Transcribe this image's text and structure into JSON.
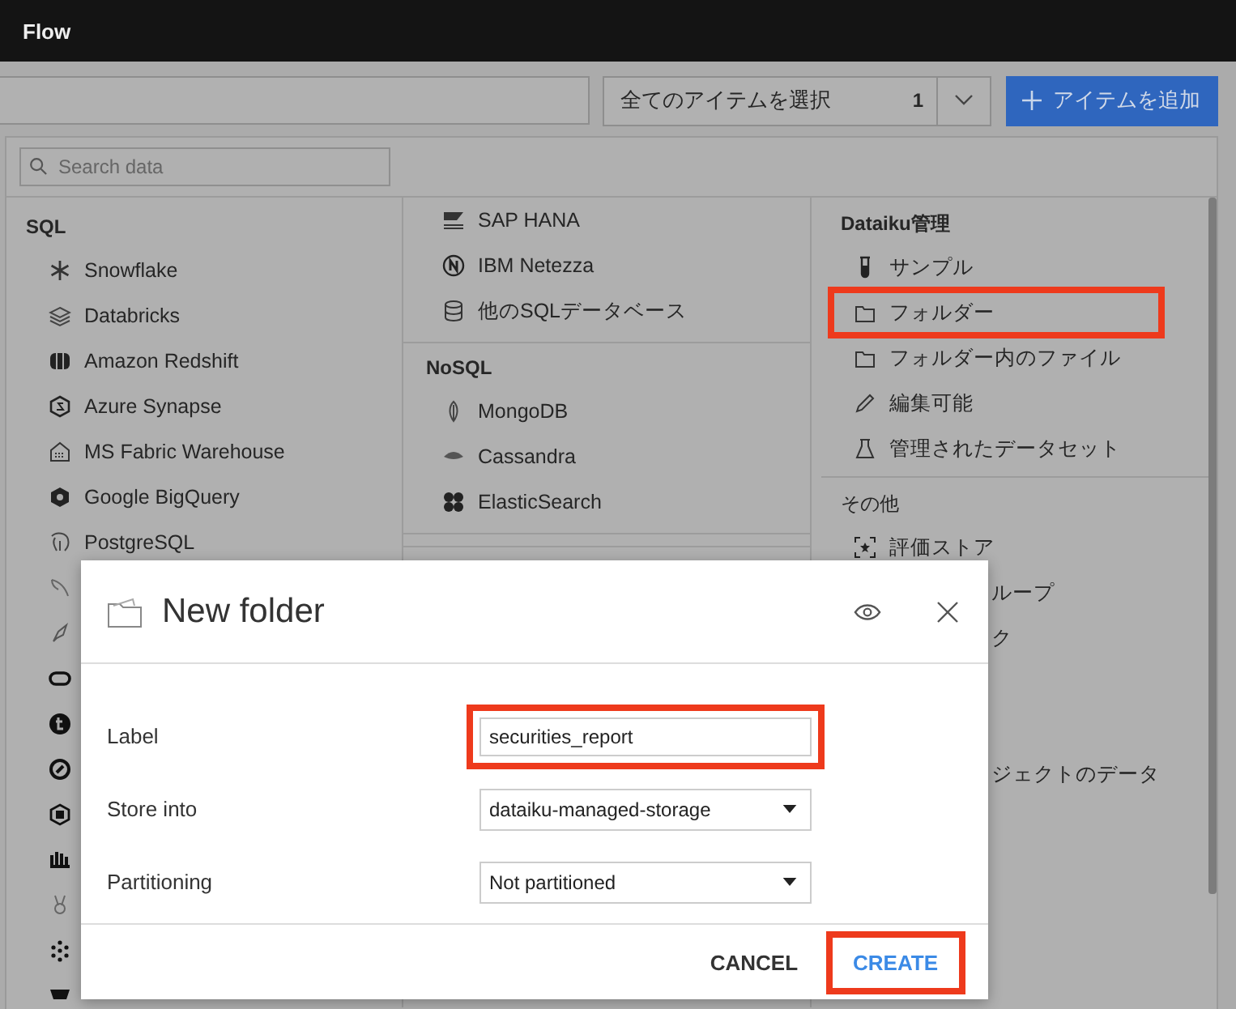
{
  "top_bar": {
    "title": "Flow"
  },
  "toolbar": {
    "select": {
      "value": "全てのアイテムを選択",
      "count": "1"
    },
    "add_button": {
      "label": "アイテムを追加"
    }
  },
  "panel": {
    "search": {
      "placeholder": "Search data"
    },
    "column_1": {
      "title": "SQL",
      "items": [
        {
          "label": "Snowflake"
        },
        {
          "label": "Databricks"
        },
        {
          "label": "Amazon Redshift"
        },
        {
          "label": "Azure Synapse"
        },
        {
          "label": "MS Fabric Warehouse"
        },
        {
          "label": "Google BigQuery"
        },
        {
          "label": "PostgreSQL"
        }
      ]
    },
    "column_2": {
      "sections": [
        {
          "items": [
            {
              "label": "SAP HANA"
            },
            {
              "label": "IBM Netezza"
            },
            {
              "label": "他のSQLデータベース"
            }
          ]
        },
        {
          "title": "NoSQL",
          "items": [
            {
              "label": "MongoDB"
            },
            {
              "label": "Cassandra"
            },
            {
              "label": "ElasticSearch"
            }
          ]
        }
      ]
    },
    "column_3": {
      "sections": [
        {
          "title": "Dataiku管理",
          "items": [
            {
              "label": "サンプル",
              "highlighted": false
            },
            {
              "label": "フォルダー",
              "highlighted": true
            },
            {
              "label": "フォルダー内のファイル",
              "highlighted": false
            },
            {
              "label": "編集可能",
              "highlighted": false
            },
            {
              "label": "管理されたデータセット",
              "highlighted": false
            }
          ]
        },
        {
          "title": "その他",
          "items": [
            {
              "label": "評価ストア",
              "highlighted": false
            }
          ],
          "partly_hidden": [
            {
              "label": "ループ"
            },
            {
              "label": "ク"
            },
            {
              "label": "ジェクトのデータ"
            }
          ]
        }
      ]
    }
  },
  "dialog": {
    "title": "New folder",
    "fields": [
      {
        "kind": "input",
        "label": "Label",
        "value": "securities_report",
        "highlighted": true
      },
      {
        "kind": "select",
        "label": "Store into",
        "value": "dataiku-managed-storage",
        "highlighted": false
      },
      {
        "kind": "select",
        "label": "Partitioning",
        "value": "Not partitioned",
        "highlighted": false
      }
    ],
    "buttons": [
      {
        "label": "CANCEL",
        "kind": "secondary",
        "highlighted": false
      },
      {
        "label": "CREATE",
        "kind": "primary",
        "highlighted": true
      }
    ]
  }
}
